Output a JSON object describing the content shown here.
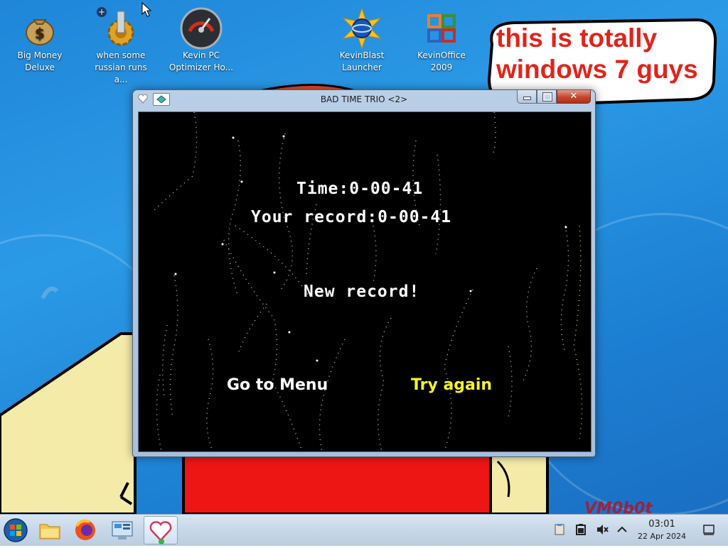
{
  "desktop": {
    "icons": [
      {
        "label": "Big Money Deluxe",
        "icon": "money-bag-icon"
      },
      {
        "label": "when some russian runs a...",
        "icon": "gear-icon"
      },
      {
        "label": "Kevin PC Optimizer Ho...",
        "icon": "speedometer-icon"
      },
      {
        "label": "KevinBlast Launcher",
        "icon": "blast-launcher-icon"
      },
      {
        "label": "KevinOffice 2009",
        "icon": "office-icon"
      }
    ],
    "speech_bubble_text": "this is totally windows 7 guys",
    "watermark": "VM0b0t"
  },
  "window": {
    "title": "BAD TIME TRIO <2>",
    "game": {
      "time_line": "Time:0-00-41",
      "record_line": "Your record:0-00-41",
      "new_record": "New record!",
      "menu_option": "Go to Menu",
      "retry_option": "Try again",
      "selected_color": "#f7f22a",
      "text_color": "#ffffff"
    }
  },
  "taskbar": {
    "buttons": [
      {
        "name": "start-button",
        "icon": "windows-orb-icon"
      },
      {
        "name": "file-explorer-button",
        "icon": "folder-icon"
      },
      {
        "name": "firefox-button",
        "icon": "firefox-icon"
      },
      {
        "name": "control-panel-button",
        "icon": "control-panel-icon"
      },
      {
        "name": "bad-time-trio-button",
        "icon": "heart-icon",
        "active": true
      }
    ],
    "clock_time": "03:01",
    "clock_date": "22 Apr 2024"
  },
  "colors": {
    "desktop_blue": "#1f86d8",
    "bubble_text": "#e0241c",
    "close_button": "#c5452c"
  }
}
